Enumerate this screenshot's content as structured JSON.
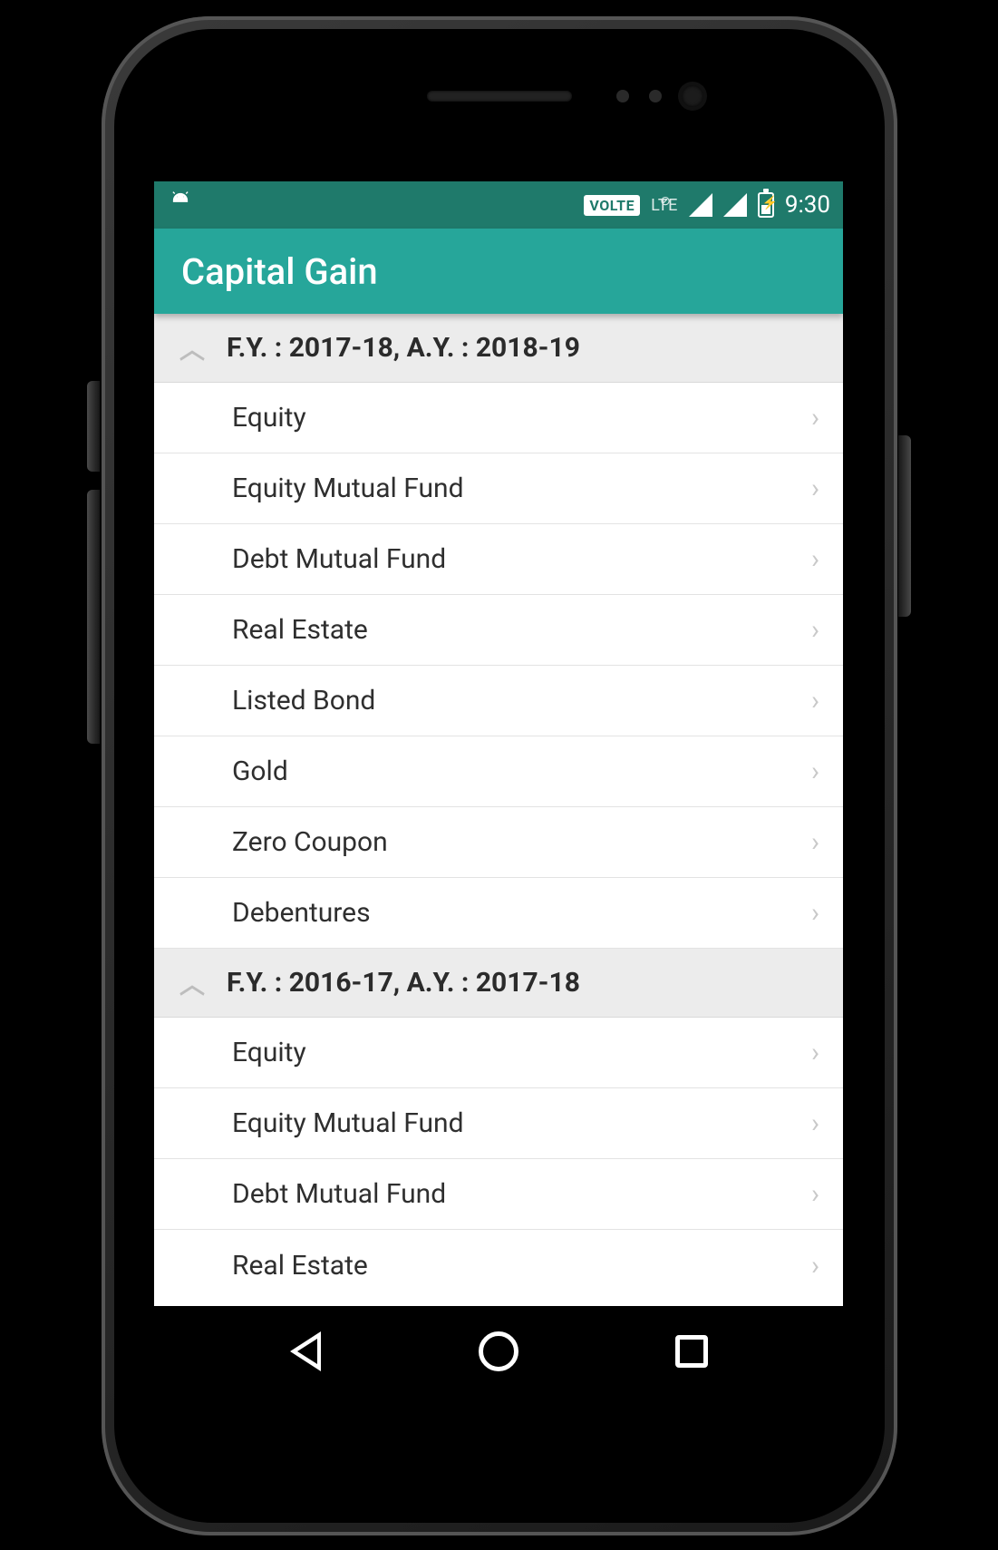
{
  "status": {
    "volte": "VOLTE",
    "lte": "LTE",
    "time": "9:30"
  },
  "appbar": {
    "title": "Capital Gain"
  },
  "sections": [
    {
      "header": "F.Y. : 2017-18,  A.Y. : 2018-19",
      "items": [
        "Equity",
        "Equity Mutual Fund",
        "Debt Mutual Fund",
        "Real Estate",
        "Listed Bond",
        "Gold",
        "Zero Coupon",
        "Debentures"
      ]
    },
    {
      "header": "F.Y. : 2016-17,  A.Y. : 2017-18",
      "items": [
        "Equity",
        "Equity Mutual Fund",
        "Debt Mutual Fund",
        "Real Estate"
      ]
    }
  ]
}
